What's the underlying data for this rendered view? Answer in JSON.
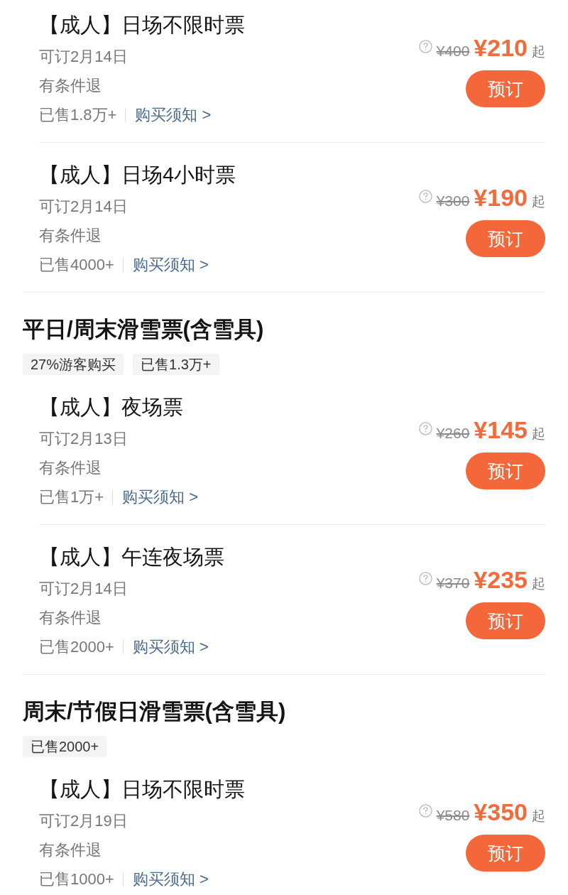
{
  "sections": [
    {
      "tickets": [
        {
          "title": "【成人】日场不限时票",
          "booking_date": "可订2月14日",
          "refund": "有条件退",
          "sold": "已售1.8万+",
          "notice_link": "购买须知 >",
          "original_price": "¥400",
          "price": "¥210",
          "price_suffix": "起",
          "button": "预订"
        },
        {
          "title": "【成人】日场4小时票",
          "booking_date": "可订2月14日",
          "refund": "有条件退",
          "sold": "已售4000+",
          "notice_link": "购买须知 >",
          "original_price": "¥300",
          "price": "¥190",
          "price_suffix": "起",
          "button": "预订"
        }
      ]
    },
    {
      "title": "平日/周末滑雪票(含雪具)",
      "tags": [
        "27%游客购买",
        "已售1.3万+"
      ],
      "tickets": [
        {
          "title": "【成人】夜场票",
          "booking_date": "可订2月13日",
          "refund": "有条件退",
          "sold": "已售1万+",
          "notice_link": "购买须知 >",
          "original_price": "¥260",
          "price": "¥145",
          "price_suffix": "起",
          "button": "预订"
        },
        {
          "title": "【成人】午连夜场票",
          "booking_date": "可订2月14日",
          "refund": "有条件退",
          "sold": "已售2000+",
          "notice_link": "购买须知 >",
          "original_price": "¥370",
          "price": "¥235",
          "price_suffix": "起",
          "button": "预订"
        }
      ]
    },
    {
      "title": "周末/节假日滑雪票(含雪具)",
      "tags": [
        "已售2000+"
      ],
      "tickets": [
        {
          "title": "【成人】日场不限时票",
          "booking_date": "可订2月19日",
          "refund": "有条件退",
          "sold": "已售1000+",
          "notice_link": "购买须知 >",
          "original_price": "¥580",
          "price": "¥350",
          "price_suffix": "起",
          "button": "预订"
        }
      ]
    }
  ]
}
